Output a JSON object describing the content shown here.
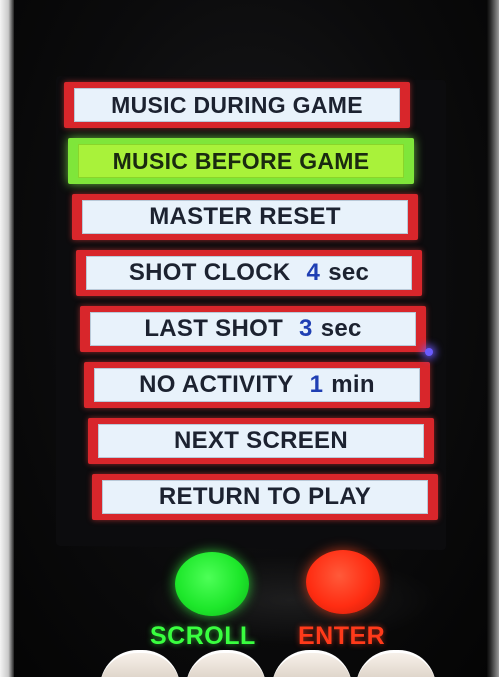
{
  "menu": {
    "items": [
      {
        "label": "MUSIC DURING GAME",
        "value": "",
        "unit": "",
        "selected": false
      },
      {
        "label": "MUSIC BEFORE GAME",
        "value": "",
        "unit": "",
        "selected": true
      },
      {
        "label": "MASTER RESET",
        "value": "",
        "unit": "",
        "selected": false
      },
      {
        "label": "SHOT CLOCK",
        "value": "4",
        "unit": "sec",
        "selected": false
      },
      {
        "label": "LAST SHOT",
        "value": "3",
        "unit": "sec",
        "selected": false
      },
      {
        "label": "NO ACTIVITY",
        "value": "1",
        "unit": "min",
        "selected": false
      },
      {
        "label": "NEXT SCREEN",
        "value": "",
        "unit": "",
        "selected": false
      },
      {
        "label": "RETURN TO PLAY",
        "value": "",
        "unit": "",
        "selected": false
      }
    ]
  },
  "buttons": {
    "scroll_label": "SCROLL",
    "enter_label": "ENTER"
  },
  "colors": {
    "item_border": "#d8262b",
    "item_face": "#e8f2fb",
    "selected_highlight": "#a9f23a",
    "value_text": "#1f3fb3",
    "scroll_button": "#1ee82b",
    "enter_button": "#ff2d12"
  },
  "icons": {
    "scroll_button": "green-circle-button",
    "enter_button": "red-circle-button"
  }
}
